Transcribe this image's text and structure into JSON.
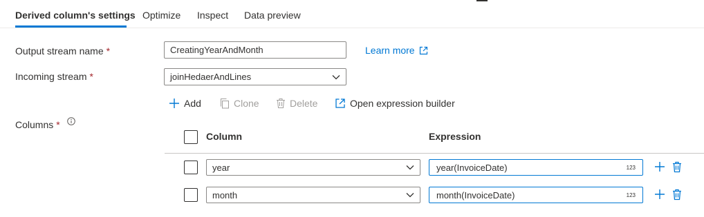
{
  "tabs": [
    {
      "label": "Derived column's settings",
      "active": true
    },
    {
      "label": "Optimize"
    },
    {
      "label": "Inspect"
    },
    {
      "label": "Data preview"
    }
  ],
  "form": {
    "output_stream": {
      "label": "Output stream name",
      "required_mark": "*",
      "value": "CreatingYearAndMonth"
    },
    "learn_more": "Learn more",
    "incoming_stream": {
      "label": "Incoming stream",
      "required_mark": "*",
      "value": "joinHedaerAndLines"
    },
    "columns": {
      "label": "Columns",
      "required_mark": "*"
    }
  },
  "toolbar": {
    "add": "Add",
    "clone": "Clone",
    "delete": "Delete",
    "open_builder": "Open expression builder"
  },
  "table": {
    "headers": {
      "column": "Column",
      "expression": "Expression"
    },
    "rows": [
      {
        "column": "year",
        "expression": "year(InvoiceDate)",
        "type_badge": "123"
      },
      {
        "column": "month",
        "expression": "month(InvoiceDate)",
        "type_badge": "123"
      }
    ]
  },
  "colors": {
    "accent": "#0078d4",
    "required": "#a4262c",
    "disabled": "#a19f9d"
  }
}
